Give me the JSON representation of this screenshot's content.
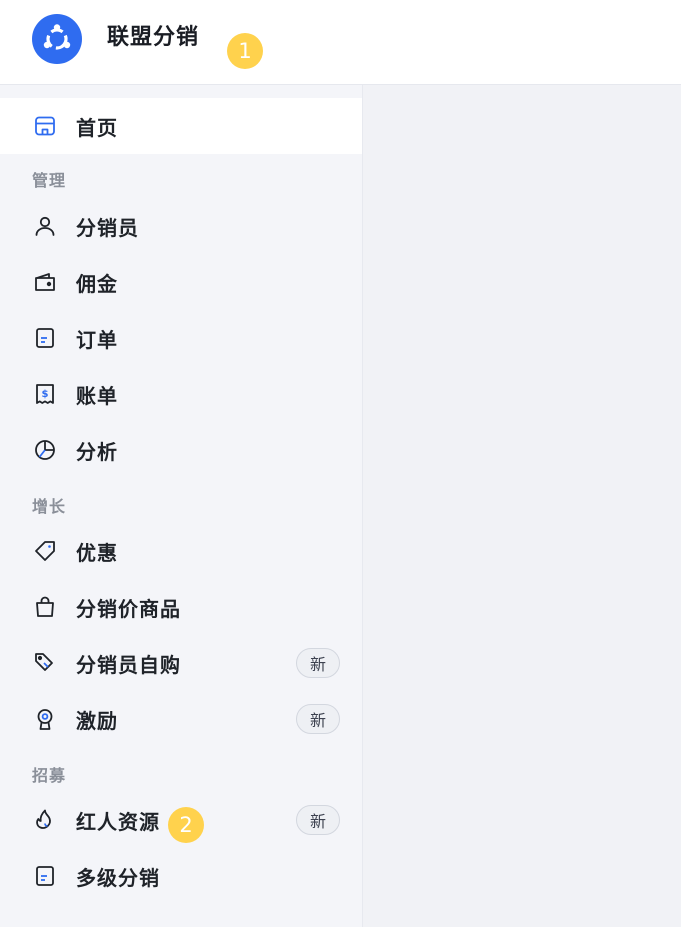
{
  "header": {
    "title": "联盟分销",
    "logo_icon": "app-logo-icon",
    "marker": "1"
  },
  "colors": {
    "accent": "#2f6cf0",
    "marker": "#ffd24d"
  },
  "sidebar": {
    "home": {
      "label": "首页",
      "icon": "store-icon"
    },
    "sections": [
      {
        "title": "管理",
        "items": [
          {
            "label": "分销员",
            "icon": "user-icon"
          },
          {
            "label": "佣金",
            "icon": "wallet-icon"
          },
          {
            "label": "订单",
            "icon": "document-icon"
          },
          {
            "label": "账单",
            "icon": "receipt-icon"
          },
          {
            "label": "分析",
            "icon": "pie-chart-icon"
          }
        ]
      },
      {
        "title": "增长",
        "items": [
          {
            "label": "优惠",
            "icon": "tag-icon"
          },
          {
            "label": "分销价商品",
            "icon": "shopping-bag-icon"
          },
          {
            "label": "分销员自购",
            "icon": "price-tags-icon",
            "badge": "新"
          },
          {
            "label": "激励",
            "icon": "award-icon",
            "badge": "新"
          }
        ]
      },
      {
        "title": "招募",
        "items": [
          {
            "label": "红人资源",
            "icon": "flame-icon",
            "badge": "新",
            "marker": "2"
          },
          {
            "label": "多级分销",
            "icon": "document-icon"
          }
        ]
      }
    ]
  }
}
